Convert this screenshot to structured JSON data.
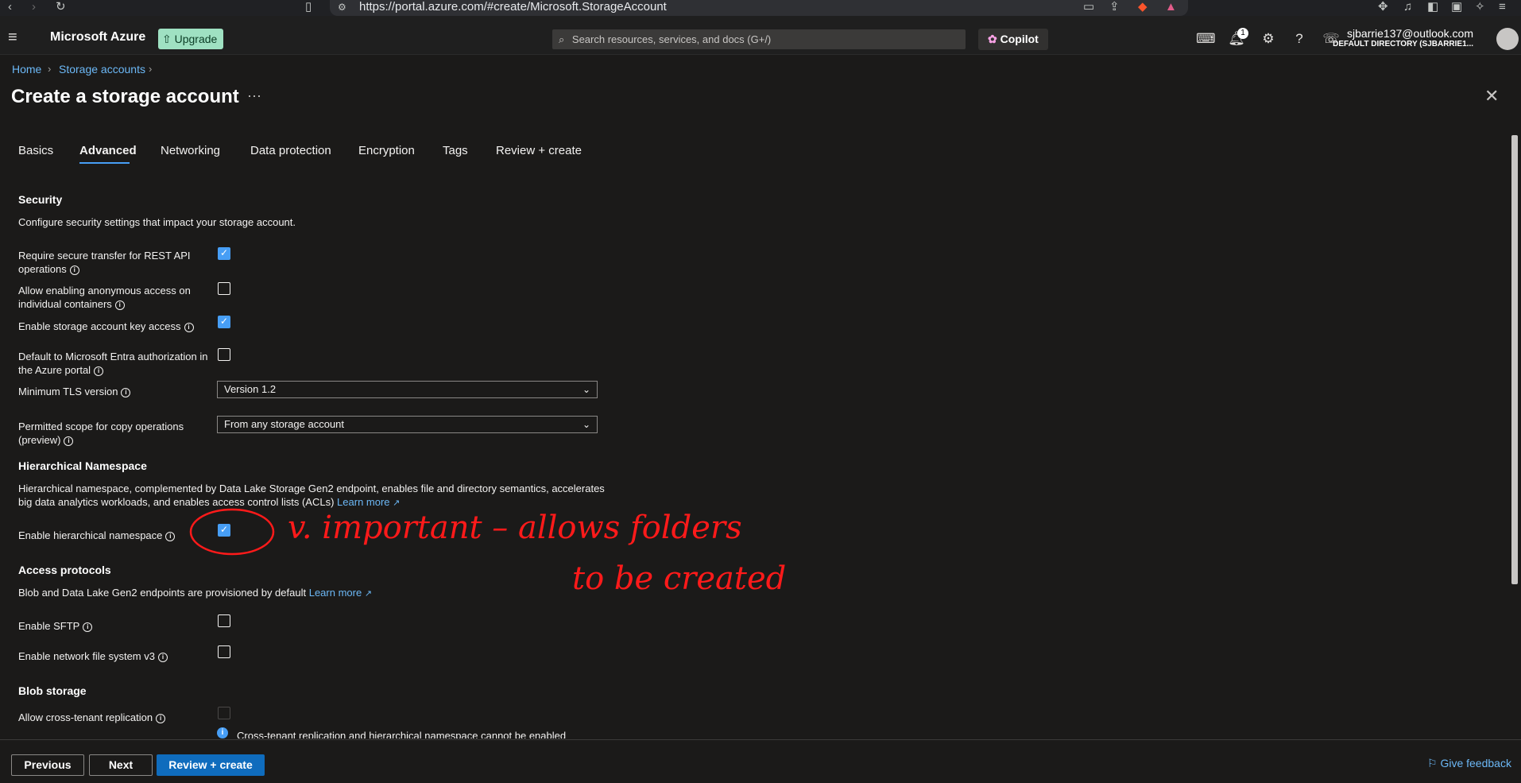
{
  "browser": {
    "url": "https://portal.azure.com/#create/Microsoft.StorageAccount"
  },
  "topbar": {
    "brand": "Microsoft Azure",
    "upgrade_label": "Upgrade",
    "search_placeholder": "Search resources, services, and docs (G+/)",
    "copilot_label": "Copilot",
    "notification_count": "1",
    "user_email": "sjbarrie137@outlook.com",
    "user_directory": "DEFAULT DIRECTORY (SJBARRIE1..."
  },
  "breadcrumb": [
    "Home",
    "Storage accounts"
  ],
  "page": {
    "title": "Create a storage account",
    "ellipsis": "···",
    "close": "✕"
  },
  "tabs": [
    {
      "label": "Basics",
      "active": false
    },
    {
      "label": "Advanced",
      "active": true
    },
    {
      "label": "Networking",
      "active": false
    },
    {
      "label": "Data protection",
      "active": false
    },
    {
      "label": "Encryption",
      "active": false
    },
    {
      "label": "Tags",
      "active": false
    },
    {
      "label": "Review + create",
      "active": false
    }
  ],
  "security": {
    "heading": "Security",
    "description": "Configure security settings that impact your storage account.",
    "settings": [
      {
        "label": "Require secure transfer for REST API operations",
        "checked": true
      },
      {
        "label": "Allow enabling anonymous access on individual containers",
        "checked": false
      },
      {
        "label": "Enable storage account key access",
        "checked": true
      },
      {
        "label": "Default to Microsoft Entra authorization in the Azure portal",
        "checked": false
      }
    ],
    "tls_label": "Minimum TLS version",
    "tls_value": "Version 1.2",
    "copy_scope_label": "Permitted scope for copy operations (preview)",
    "copy_scope_value": "From any storage account"
  },
  "hns": {
    "heading": "Hierarchical Namespace",
    "description": "Hierarchical namespace, complemented by Data Lake Storage Gen2 endpoint, enables file and directory semantics, accelerates big data analytics workloads, and enables access control lists (ACLs)",
    "learn_more": "Learn more",
    "enable_label": "Enable hierarchical namespace",
    "enabled": true
  },
  "annotation": {
    "line1": "v. important  – allows folders",
    "line2": "to be created",
    "color": "#ff1a1a"
  },
  "access": {
    "heading": "Access protocols",
    "description": "Blob and Data Lake Gen2 endpoints are provisioned by default",
    "learn_more": "Learn more",
    "sftp_label": "Enable SFTP",
    "sftp": false,
    "nfs_label": "Enable network file system v3",
    "nfs": false
  },
  "blob": {
    "heading": "Blob storage",
    "cross_tenant_label": "Allow cross-tenant replication",
    "cross_tenant": false,
    "info_text": "Cross-tenant replication and hierarchical namespace cannot be enabled"
  },
  "footer": {
    "previous": "Previous",
    "next": "Next",
    "review": "Review + create",
    "feedback": "Give feedback"
  },
  "colors": {
    "accent": "#479ef5",
    "primary_button": "#0f6cbd",
    "link": "#6cb8f6",
    "background": "#1b1a19"
  }
}
